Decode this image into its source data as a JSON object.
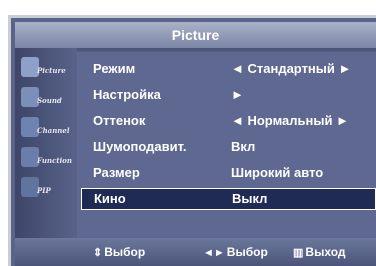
{
  "title": "Picture",
  "sidebar": [
    {
      "label": "Picture",
      "icon": "picture-icon",
      "color": "#8ea0c8"
    },
    {
      "label": "Sound",
      "icon": "sound-icon",
      "color": "#7c8fb7"
    },
    {
      "label": "Channel",
      "icon": "channel-icon",
      "color": "#6f83b0"
    },
    {
      "label": "Function",
      "icon": "function-icon",
      "color": "#6a7ea9"
    },
    {
      "label": "PIP",
      "icon": "pip-icon",
      "color": "#6074a0"
    }
  ],
  "menu": [
    {
      "label": "Режим",
      "value": "◄ Стандартный ►"
    },
    {
      "label": "Настройка",
      "value": "►"
    },
    {
      "label": "Оттенок",
      "value": "◄ Нормальный ►"
    },
    {
      "label": "Шумоподавит.",
      "value": "Вкл"
    },
    {
      "label": "Размер",
      "value": "Широкий авто"
    },
    {
      "label": "Кино",
      "value": "Выкл",
      "selected": true
    }
  ],
  "footer": {
    "move": {
      "glyph": "⇕",
      "text": "Выбор"
    },
    "adjust": {
      "glyph": "◄►",
      "text": "Выбор"
    },
    "exit": {
      "glyph": "▥",
      "text": "Выход"
    }
  }
}
